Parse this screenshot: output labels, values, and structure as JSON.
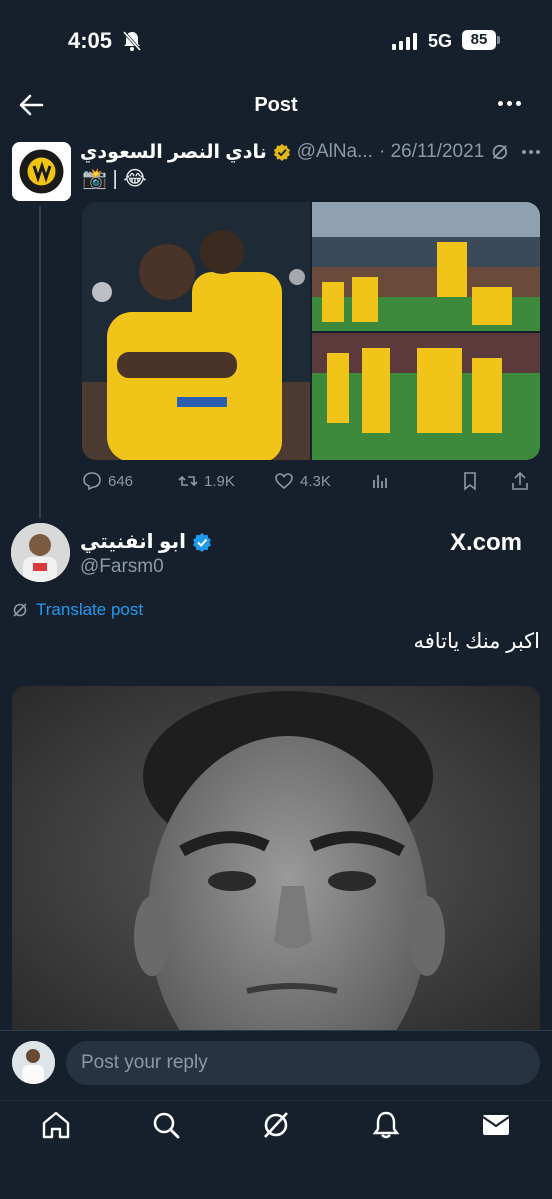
{
  "status_bar": {
    "time": "4:05",
    "network": "5G",
    "battery": "85"
  },
  "header": {
    "title": "Post"
  },
  "tweet1": {
    "name": "نادي النصر السعودي",
    "handle": "@AlNa...",
    "date": "· 26/11/2021",
    "text": "📸 | 😂",
    "replies": "646",
    "reposts": "1.9K",
    "likes": "4.3K"
  },
  "tweet2": {
    "name": "ابو انفنيتي",
    "handle": "@Farsm0",
    "watermark": "X.com",
    "translate_label": "Translate post",
    "text": "اكبر منك ياتافه"
  },
  "reply": {
    "placeholder": "Post your reply"
  },
  "colors": {
    "background": "#16202c",
    "accent": "#1d9bf0",
    "muted": "#8b98a5",
    "verified_gold": "#e2b719",
    "verified_blue": "#1d9bf0"
  },
  "icons": [
    "bell-slash-icon",
    "signal-icon",
    "battery-icon",
    "back-arrow-icon",
    "more-icon",
    "gold-verified-icon",
    "blue-verified-icon",
    "grok-icon",
    "reply-icon",
    "repost-icon",
    "like-icon",
    "views-icon",
    "bookmark-icon",
    "share-icon",
    "translate-icon",
    "home-icon",
    "search-icon",
    "grok-tab-icon",
    "notifications-icon",
    "messages-icon"
  ]
}
